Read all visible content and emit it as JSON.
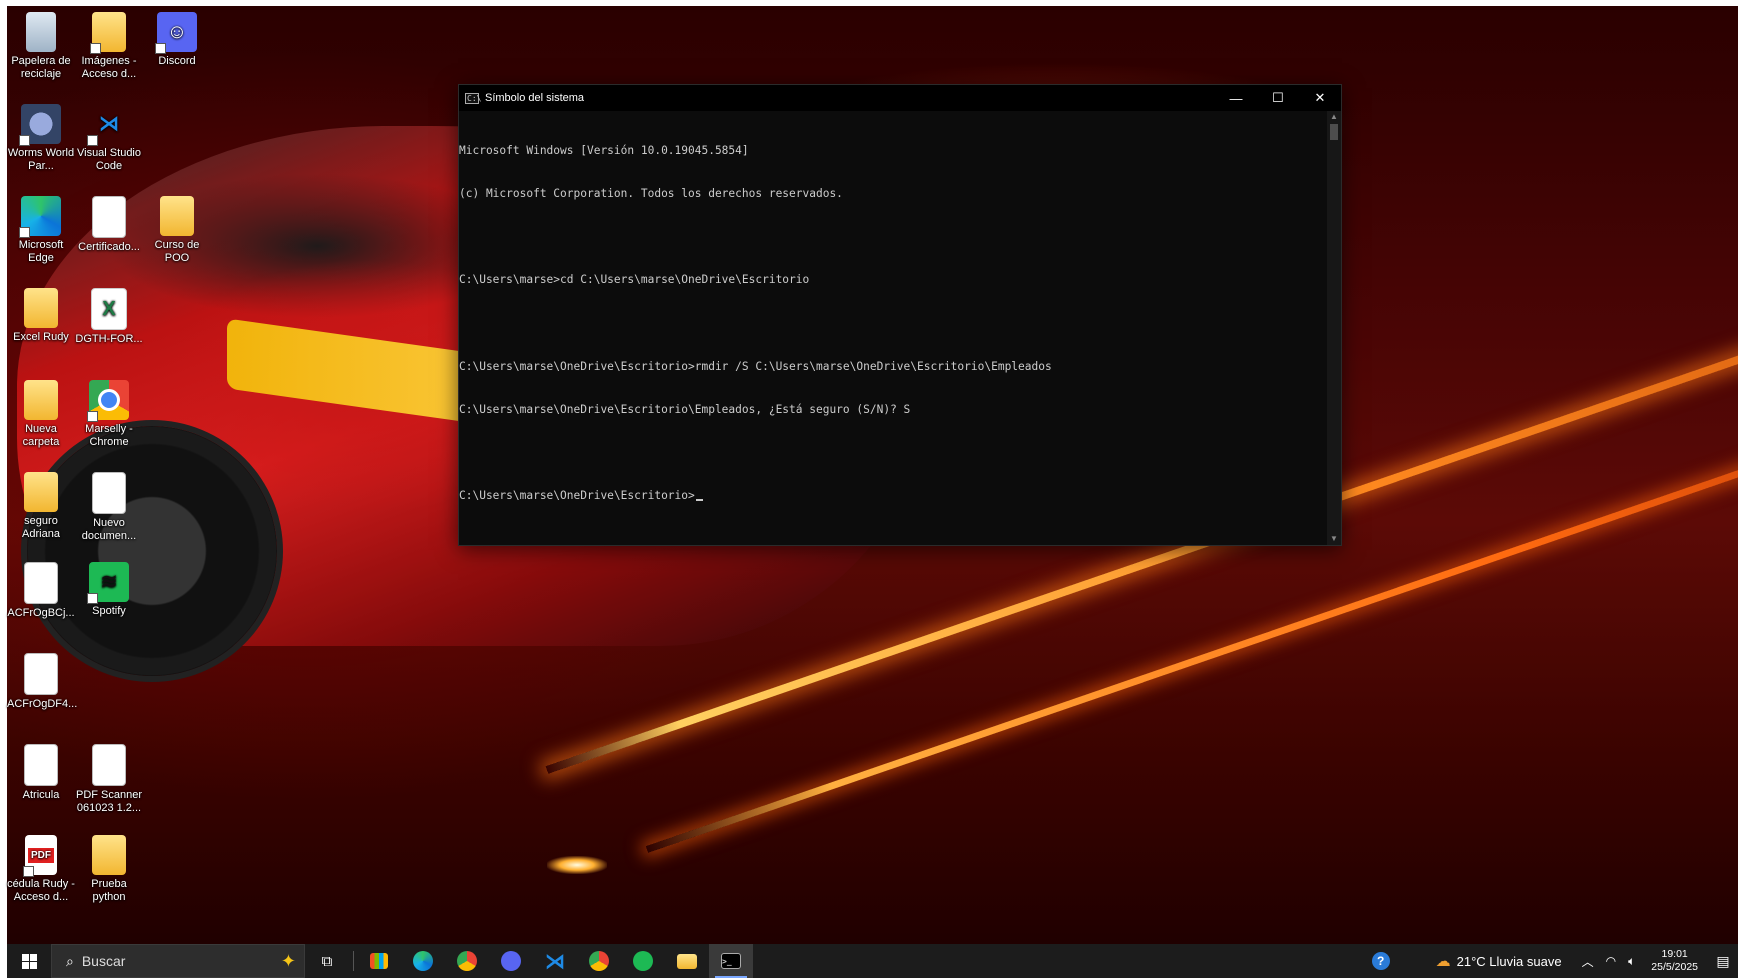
{
  "desktop": {
    "icons": [
      {
        "label": "Papelera de reciclaje",
        "icon": "recycle-bin-icon"
      },
      {
        "label": "Imágenes - Acceso d...",
        "icon": "pictures-folder-icon"
      },
      {
        "label": "Discord",
        "icon": "discord-icon"
      },
      {
        "label": "Worms World Par...",
        "icon": "worms-icon"
      },
      {
        "label": "Visual Studio Code",
        "icon": "vscode-icon"
      },
      {
        "label": "Microsoft Edge",
        "icon": "edge-icon"
      },
      {
        "label": "Certificado...",
        "icon": "document-icon"
      },
      {
        "label": "Curso de POO",
        "icon": "folder-icon"
      },
      {
        "label": "Excel Rudy",
        "icon": "folder-icon"
      },
      {
        "label": "DGTH-FOR...",
        "icon": "excel-icon"
      },
      {
        "label": "Nueva carpeta",
        "icon": "folder-icon"
      },
      {
        "label": "Marselly - Chrome",
        "icon": "chrome-icon"
      },
      {
        "label": "seguro Adriana",
        "icon": "folder-icon"
      },
      {
        "label": "Nuevo documen...",
        "icon": "text-document-icon"
      },
      {
        "label": "ACFrOgBCj...",
        "icon": "document-icon"
      },
      {
        "label": "Spotify",
        "icon": "spotify-icon"
      },
      {
        "label": "ACFrOgDF4...",
        "icon": "document-icon"
      },
      {
        "label": "Atricula",
        "icon": "document-icon"
      },
      {
        "label": "PDF Scanner 061023 1.2...",
        "icon": "document-icon"
      },
      {
        "label": "cédula Rudy - Acceso d...",
        "icon": "pdf-icon"
      },
      {
        "label": "Prueba python",
        "icon": "folder-icon"
      }
    ]
  },
  "cmd": {
    "title": "Símbolo del sistema",
    "app_icon_text": "C:\\",
    "minimize": "—",
    "maximize": "☐",
    "close": "✕",
    "lines": [
      "Microsoft Windows [Versión 10.0.19045.5854]",
      "(c) Microsoft Corporation. Todos los derechos reservados.",
      "",
      "C:\\Users\\marse>cd C:\\Users\\marse\\OneDrive\\Escritorio",
      "",
      "C:\\Users\\marse\\OneDrive\\Escritorio>rmdir /S C:\\Users\\marse\\OneDrive\\Escritorio\\Empleados",
      "C:\\Users\\marse\\OneDrive\\Escritorio\\Empleados, ¿Está seguro (S/N)? S",
      ""
    ],
    "prompt": "C:\\Users\\marse\\OneDrive\\Escritorio>"
  },
  "taskbar": {
    "search_placeholder": "Buscar",
    "pinned": [
      "task-view-icon",
      "store-icon",
      "edge-icon",
      "chrome-icon",
      "discord-icon",
      "vscode-icon",
      "chrome-icon",
      "spotify-icon",
      "file-explorer-icon",
      "cmd-icon"
    ],
    "weather": "21°C  Lluvia suave",
    "time": "19:01",
    "date": "25/5/2025"
  }
}
